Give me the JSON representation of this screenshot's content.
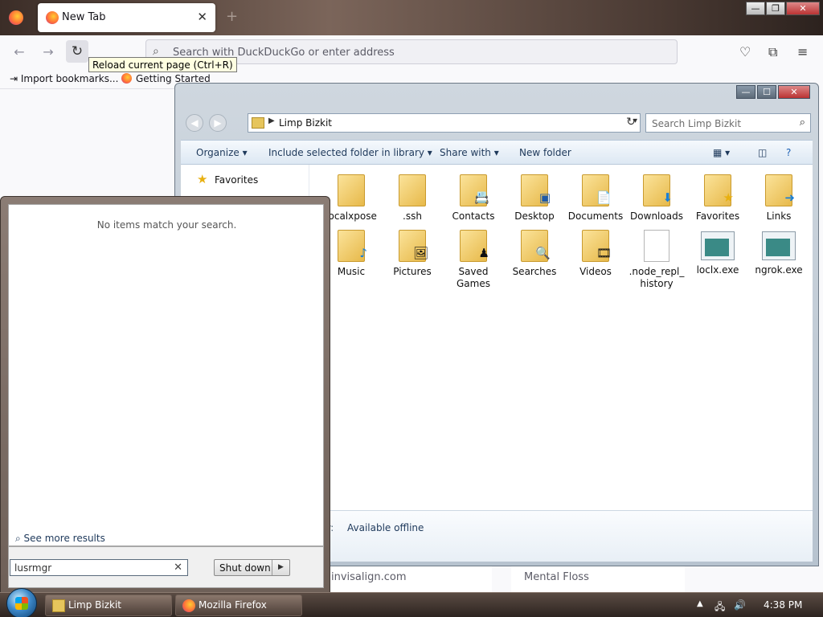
{
  "firefox": {
    "tab_title": "New Tab",
    "close_tab": "✕",
    "new_tab": "+",
    "url_placeholder": "Search with DuckDuckGo or enter address",
    "tooltip": "Reload current page (Ctrl+R)",
    "bookmarks": [
      "Import bookmarks...",
      "Getting Started"
    ],
    "cards": [
      "invisalign.com",
      "Mental Floss"
    ],
    "window_buttons": {
      "minimize": "—",
      "maximize": "❐",
      "close": "✕"
    }
  },
  "explorer": {
    "path": "Limp Bizkit",
    "search_placeholder": "Search Limp Bizkit",
    "commands": [
      "Organize",
      "Include selected folder in library",
      "Share with",
      "New folder"
    ],
    "favorites": "Favorites",
    "items": [
      {
        "label": "localxpose",
        "kind": "folder"
      },
      {
        "label": ".ssh",
        "kind": "folder"
      },
      {
        "label": "Contacts",
        "kind": "folder"
      },
      {
        "label": "Desktop",
        "kind": "folder"
      },
      {
        "label": "Documents",
        "kind": "folder"
      },
      {
        "label": "Downloads",
        "kind": "folder"
      },
      {
        "label": "Favorites",
        "kind": "folder"
      },
      {
        "label": "Links",
        "kind": "folder"
      },
      {
        "label": "Music",
        "kind": "folder"
      },
      {
        "label": "Pictures",
        "kind": "folder"
      },
      {
        "label": "Saved Games",
        "kind": "folder"
      },
      {
        "label": "Searches",
        "kind": "folder"
      },
      {
        "label": "Videos",
        "kind": "folder"
      },
      {
        "label": ".node_repl_history",
        "kind": "file"
      },
      {
        "label": "loclx.exe",
        "kind": "exe"
      },
      {
        "label": "ngrok.exe",
        "kind": "exe"
      }
    ],
    "details_label": "y:",
    "details_value": "Available offline"
  },
  "start_menu": {
    "no_items": "No items match your search.",
    "see_more": "See more results",
    "search_value": "lusrmgr",
    "shutdown": "Shut down"
  },
  "taskbar": {
    "tasks": [
      "Limp Bizkit",
      "Mozilla Firefox"
    ],
    "time": "4:38 PM"
  }
}
